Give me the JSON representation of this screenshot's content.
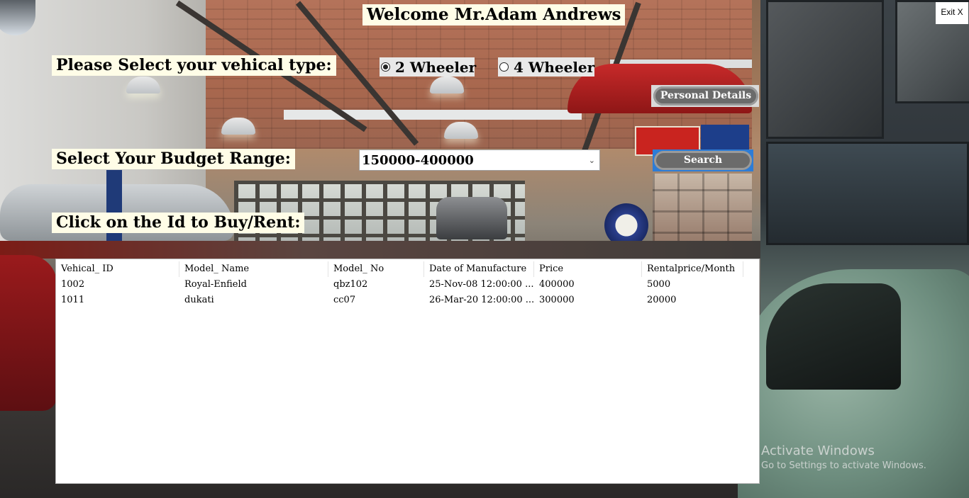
{
  "header": {
    "welcome_text": "Welcome Mr.Adam Andrews"
  },
  "vehicle_type": {
    "label": "Please Select your vehical type:",
    "options": [
      {
        "label": "2 Wheeler",
        "selected": true
      },
      {
        "label": "4 Wheeler",
        "selected": false
      }
    ]
  },
  "personal_details_button": "Personal Details",
  "budget": {
    "label": "Select Your Budget Range:",
    "selected_value": "150000-400000"
  },
  "search_button": "Search",
  "click_id_label": "Click on the Id to Buy/Rent:",
  "exit_button": "Exit X",
  "table": {
    "columns": [
      "Vehical_ ID",
      "Model_ Name",
      "Model_ No",
      "Date of Manufacture",
      "Price",
      "Rentalprice/Month"
    ],
    "rows": [
      [
        "1002",
        "Royal-Enfield",
        "qbz102",
        "25-Nov-08 12:00:00 ...",
        "400000",
        "5000"
      ],
      [
        "1011",
        "dukati",
        "cc07",
        "26-Mar-20 12:00:00 ...",
        "300000",
        "20000"
      ]
    ]
  },
  "watermark": {
    "line1": "Activate Windows",
    "line2": "Go to Settings to activate Windows."
  },
  "colors": {
    "label_bg": "#fffde7",
    "button_gray": "#6b6b6b",
    "search_focus": "#2d7cd6"
  },
  "icons": {
    "dropdown": "chevron-down-icon"
  }
}
